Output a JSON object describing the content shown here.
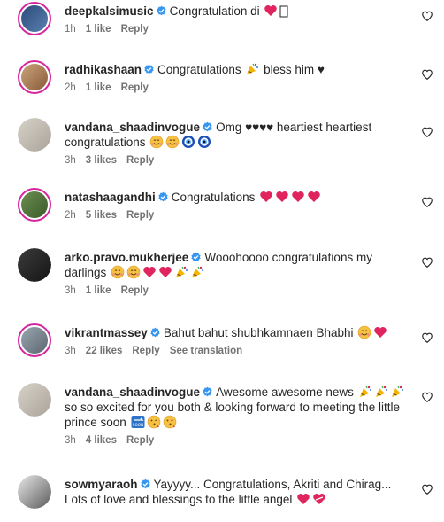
{
  "comments": [
    {
      "username": "deepkalsimusic",
      "text": "Congratulation di",
      "emoji_after": [
        "red-heart",
        "missing-glyph"
      ],
      "time": "1h",
      "likes": "1 like",
      "reply": "Reply",
      "story_ring": true
    },
    {
      "username": "radhikashaan",
      "text": "Congratulations",
      "text_after": "bless him ♥",
      "emoji_after": [
        "party-popper"
      ],
      "time": "2h",
      "likes": "1 like",
      "reply": "Reply",
      "story_ring": true
    },
    {
      "username": "vandana_shaadinvogue",
      "text": "Omg ♥♥♥♥ heartiest heartiest congratulations",
      "emoji_after": [
        "smiling-hearts",
        "smiling-hearts",
        "evil-eye",
        "evil-eye"
      ],
      "time": "3h",
      "likes": "3 likes",
      "reply": "Reply",
      "story_ring": false
    },
    {
      "username": "natashaagandhi",
      "text": "Congratulations",
      "emoji_after": [
        "red-heart",
        "red-heart",
        "red-heart",
        "red-heart"
      ],
      "time": "2h",
      "likes": "5 likes",
      "reply": "Reply",
      "story_ring": true
    },
    {
      "username": "arko.pravo.mukherjee",
      "text": "Wooohoooo congratulations my darlings",
      "emoji_after": [
        "smiling-hearts",
        "smiling-hearts",
        "red-heart",
        "red-heart",
        "party-popper",
        "party-popper"
      ],
      "time": "3h",
      "likes": "1 like",
      "reply": "Reply",
      "story_ring": false
    },
    {
      "username": "vikrantmassey",
      "text": "Bahut bahut shubhkamnaen Bhabhi",
      "emoji_after": [
        "smiling-hearts",
        "red-heart"
      ],
      "time": "3h",
      "likes": "22 likes",
      "reply": "Reply",
      "translate": "See translation",
      "story_ring": true
    },
    {
      "username": "vandana_shaadinvogue",
      "text": "Awesome awesome news",
      "text2": "so so excited for you both & looking forward to meeting the little prince soon",
      "emoji_after": [
        "party-popper",
        "party-popper",
        "party-popper"
      ],
      "emoji_after2": [
        "soon-arrow",
        "kissing-face",
        "kissing-face"
      ],
      "time": "3h",
      "likes": "4 likes",
      "reply": "Reply",
      "story_ring": false
    },
    {
      "username": "sowmyaraoh",
      "text": "Yayyyy... Congratulations, Akriti and Chirag...",
      "text2": "Lots of love and blessings to the little angel",
      "emoji_after2": [
        "red-heart",
        "mending-heart"
      ],
      "time": "",
      "likes": "",
      "reply": "",
      "story_ring": false
    }
  ],
  "colors": {
    "verified": "#3797f0",
    "meta": "#737373",
    "heart": "#e0245e",
    "story_ring": "#d6249f"
  }
}
